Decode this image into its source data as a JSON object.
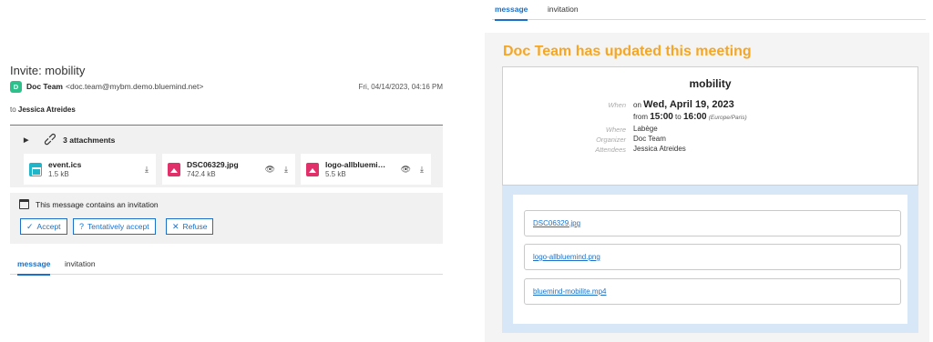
{
  "left": {
    "subject": "Invite: mobility",
    "sender": {
      "avatar_letter": "D",
      "name": "Doc Team",
      "email": "<doc.team@mybm.demo.bluemind.net>",
      "date": "Fri, 04/14/2023, 04:16 PM"
    },
    "to_prefix": "to",
    "to_name": "Jessica Atreides",
    "attachments": {
      "header": "3 attachments",
      "items": [
        {
          "name": "event.ics",
          "size": "1.5 kB",
          "type": "calendar"
        },
        {
          "name": "DSC06329.jpg",
          "size": "742.4 kB",
          "type": "image"
        },
        {
          "name": "logo-allbluemi…",
          "size": "5.5 kB",
          "type": "image"
        }
      ]
    },
    "invitation": {
      "message": "This message contains an invitation",
      "accept_label": "Accept",
      "tentative_label": "Tentatively accept",
      "refuse_label": "Refuse"
    },
    "tabs": [
      "message",
      "invitation"
    ]
  },
  "right": {
    "tabs": [
      "message",
      "invitation"
    ],
    "update_title": "Doc Team has updated this meeting",
    "meeting": {
      "title": "mobility",
      "when_label": "When",
      "when_on": "on",
      "when_date": "Wed, April 19, 2023",
      "from_word": "from",
      "start_time": "15:00",
      "to_word": "to",
      "end_time": "16:00",
      "timezone": "(Europe/Paris)",
      "where_label": "Where",
      "where_value": "Labège",
      "organizer_label": "Organizer",
      "organizer_value": "Doc Team",
      "attendees_label": "Attendees",
      "attendees_value": "Jessica Atreides"
    },
    "links": [
      "DSC06329.jpg",
      "logo-allbluemind.png",
      "bluemind-mobilite.mp4"
    ]
  },
  "colors": {
    "accent": "#1b71c9",
    "update_title": "#f5a623",
    "avatar": "#2ebf8a",
    "ics_icon": "#21b5c9",
    "image_icon": "#e0316a"
  }
}
